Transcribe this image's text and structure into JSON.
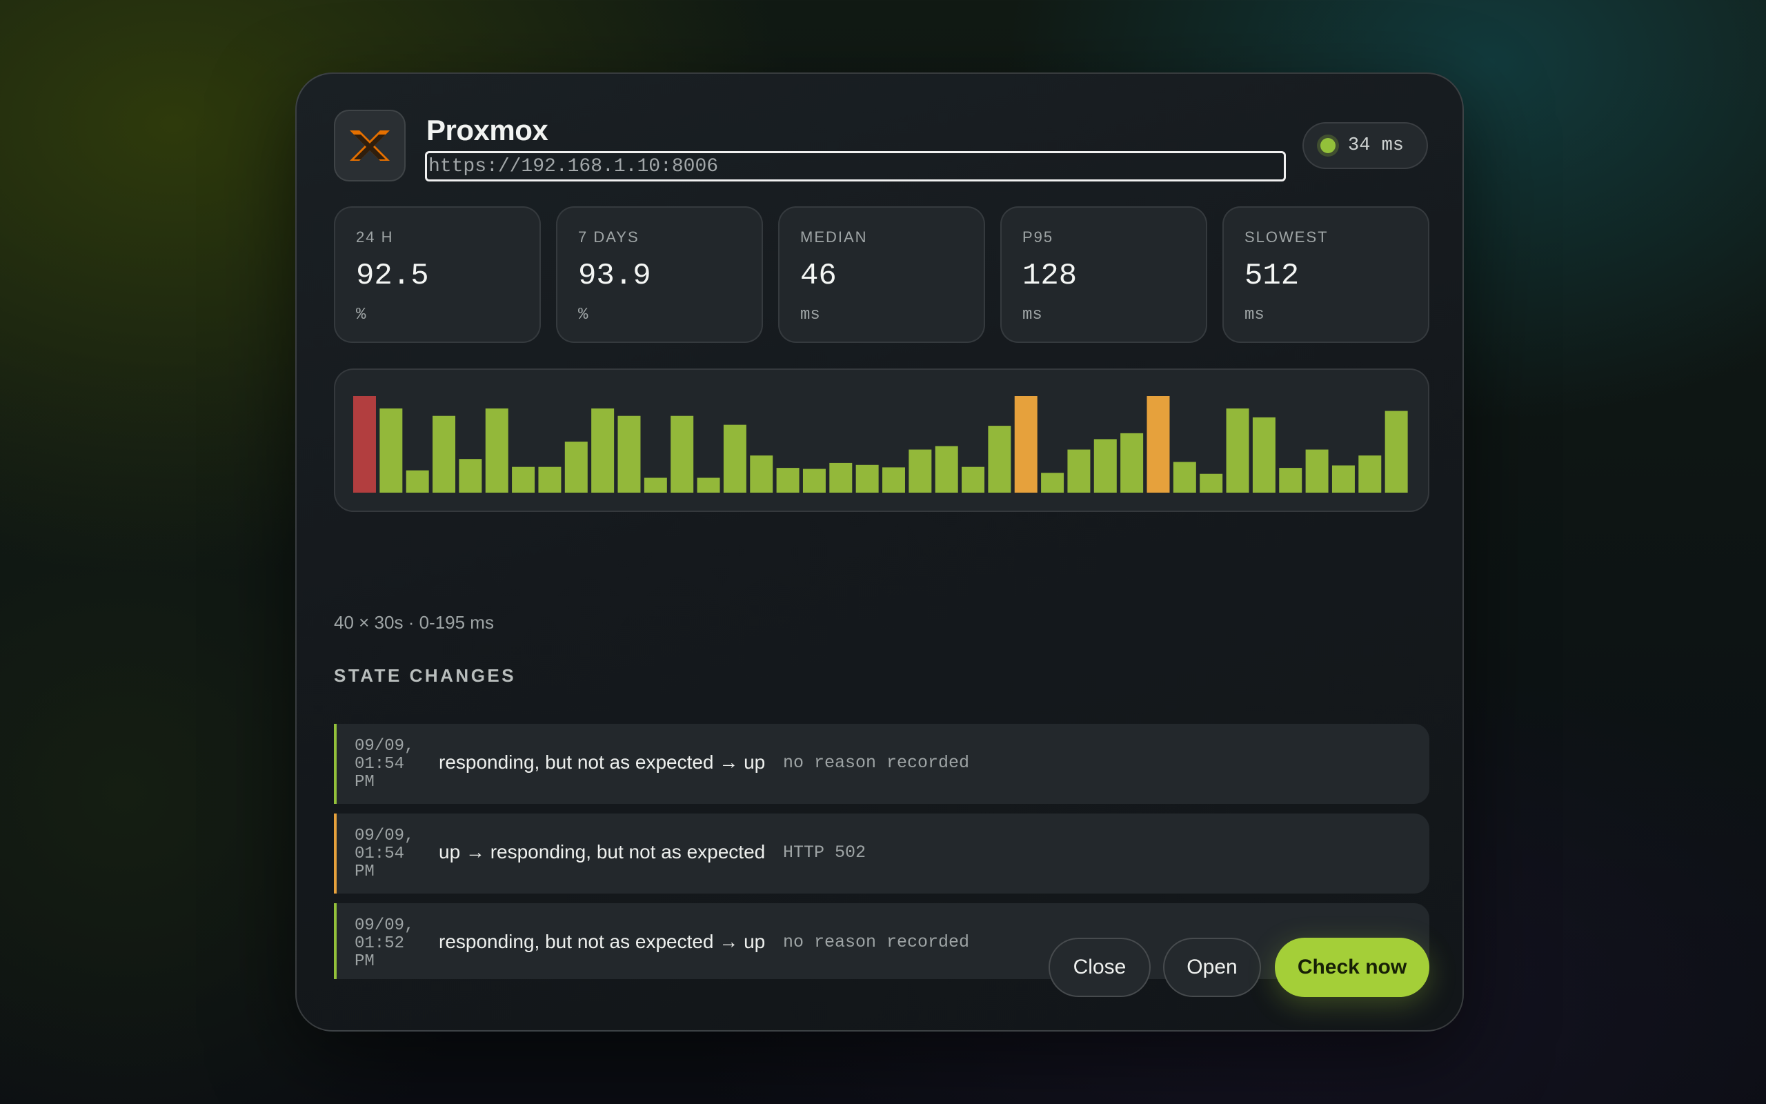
{
  "app": {
    "name": "Proxmox",
    "url_value": "https://192.168.1.10:8006",
    "icon": "proxmox-logo"
  },
  "latency": {
    "status": "up",
    "label": "34 ms"
  },
  "stats": [
    {
      "label": "24 H",
      "value": "92.5",
      "unit": "%"
    },
    {
      "label": "7 DAYS",
      "value": "93.9",
      "unit": "%"
    },
    {
      "label": "MEDIAN",
      "value": "46",
      "unit": "ms"
    },
    {
      "label": "P95",
      "value": "128",
      "unit": "ms"
    },
    {
      "label": "SLOWEST",
      "value": "512",
      "unit": "ms"
    }
  ],
  "chart_data": {
    "type": "bar",
    "caption": "40 × 30s · 0-195 ms",
    "ylim": [
      0,
      195
    ],
    "values": [
      195,
      170,
      45,
      155,
      68,
      170,
      52,
      52,
      103,
      170,
      155,
      30,
      155,
      30,
      137,
      75,
      50,
      48,
      60,
      56,
      51,
      87,
      94,
      52,
      135,
      195,
      40,
      87,
      108,
      120,
      195,
      62,
      38,
      170,
      152,
      50,
      87,
      55,
      75,
      165
    ],
    "status": [
      "down",
      "up",
      "up",
      "up",
      "up",
      "up",
      "up",
      "up",
      "up",
      "up",
      "up",
      "up",
      "up",
      "up",
      "up",
      "up",
      "up",
      "up",
      "up",
      "up",
      "up",
      "up",
      "up",
      "up",
      "up",
      "degraded",
      "up",
      "up",
      "up",
      "up",
      "degraded",
      "up",
      "up",
      "up",
      "up",
      "up",
      "up",
      "up",
      "up",
      "up"
    ],
    "colors": {
      "up": "#93b83a",
      "degraded": "#e6a13c",
      "down": "#b23e3f"
    }
  },
  "state_changes": {
    "title": "STATE CHANGES",
    "items": [
      {
        "time": "09/09, 01:54 PM",
        "transition": "responding, but not as expected → up",
        "reason": "no reason recorded",
        "kind": "up"
      },
      {
        "time": "09/09, 01:54 PM",
        "transition": "up → responding, but not as expected",
        "reason": "HTTP 502",
        "kind": "degraded"
      },
      {
        "time": "09/09, 01:52 PM",
        "transition": "responding, but not as expected → up",
        "reason": "no reason recorded",
        "kind": "up"
      }
    ]
  },
  "buttons": {
    "close": "Close",
    "open": "Open",
    "check": "Check now"
  },
  "colors": {
    "accent": "#a4cf38",
    "up": "#93c13a",
    "degraded": "#e6a13c",
    "down": "#b23e3f",
    "logo": "#e57000"
  }
}
